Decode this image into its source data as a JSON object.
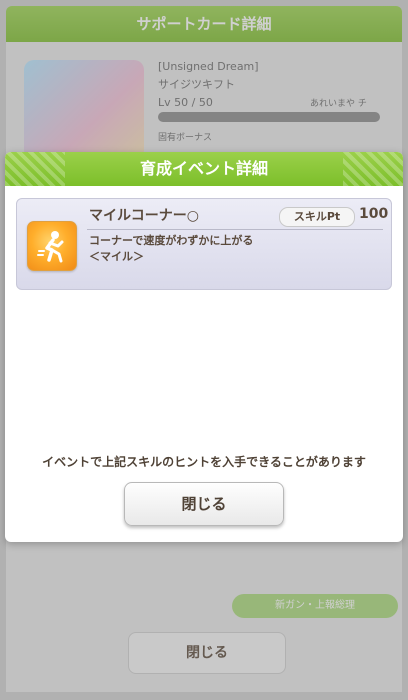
{
  "background": {
    "header_title": "サポートカード詳細",
    "card_subtitle": "[Unsigned Dream]",
    "card_name": "サイジツキフト",
    "level": "Lv 50 / 50",
    "level_note": "あれいまや チ",
    "bonus_label": "固有ボーナス",
    "green_button_label": "新ガン・上報総理",
    "close_label": "閉じる"
  },
  "dialog": {
    "title": "育成イベント詳細",
    "skill": {
      "name": "マイルコーナー○",
      "pt_label": "スキルPt",
      "pt_value": "100",
      "description_line1": "コーナーで速度がわずかに上がる",
      "description_line2": "＜マイル＞",
      "icon": "running-figure-icon"
    },
    "notice": "イベントで上記スキルのヒントを入手できることがあります",
    "close_label": "閉じる"
  },
  "colors": {
    "header_green": "#8cc63f",
    "text_brown": "#5a4a3c",
    "skill_icon_orange": "#ffae2b"
  }
}
